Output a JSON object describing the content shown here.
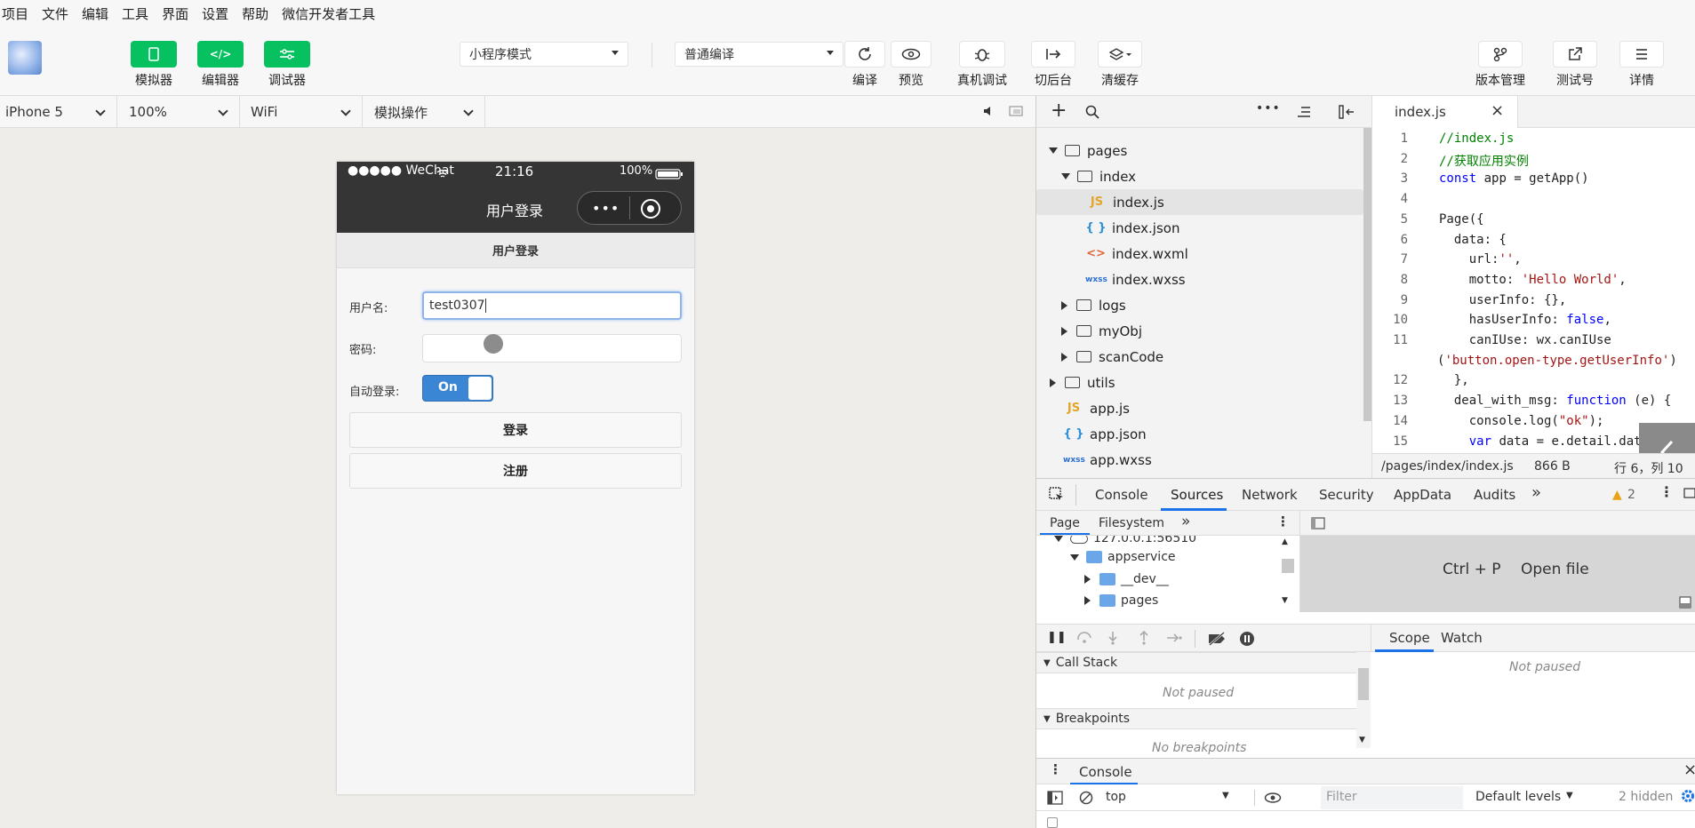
{
  "menu": [
    "项目",
    "文件",
    "编辑",
    "工具",
    "界面",
    "设置",
    "帮助",
    "微信开发者工具"
  ],
  "toolbar": {
    "simulator": "模拟器",
    "editor": "编辑器",
    "debugger": "调试器",
    "mode_select": "小程序模式",
    "compile_select": "普通编译",
    "compile": "编译",
    "preview": "预览",
    "remote_debug": "真机调试",
    "switch_bg": "切后台",
    "clear_cache": "清缓存",
    "version": "版本管理",
    "test_account": "测试号",
    "details": "详情"
  },
  "devicebar": {
    "device": "iPhone 5",
    "zoom": "100%",
    "network": "WiFi",
    "operation": "模拟操作"
  },
  "phone": {
    "carrier": "●●●●● WeChat",
    "time": "21:16",
    "battery": "100%",
    "nav_title": "用户登录",
    "page_header": "用户登录",
    "username_label": "用户名:",
    "username_value": "test0307",
    "password_label": "密码:",
    "autologin_label": "自动登录:",
    "switch_text": "On",
    "login_button": "登录",
    "register_button": "注册"
  },
  "explorer": {
    "items": [
      {
        "label": "pages"
      },
      {
        "label": "index"
      },
      {
        "label": "index.js",
        "icon": "JS"
      },
      {
        "label": "index.json",
        "icon": "{ }"
      },
      {
        "label": "index.wxml",
        "icon": "<>"
      },
      {
        "label": "index.wxss",
        "icon": "wxss"
      },
      {
        "label": "logs"
      },
      {
        "label": "myObj"
      },
      {
        "label": "scanCode"
      },
      {
        "label": "utils"
      },
      {
        "label": "app.js",
        "icon": "JS"
      },
      {
        "label": "app.json",
        "icon": "{ }"
      },
      {
        "label": "app.wxss",
        "icon": "wxss"
      }
    ]
  },
  "editor": {
    "tab": "index.js",
    "line_numbers": [
      "1",
      "2",
      "3",
      "4",
      "5",
      "6",
      "7",
      "8",
      "9",
      "10",
      "11",
      "",
      "12",
      "13",
      "14",
      "15"
    ],
    "lines": [
      "//index.js",
      "//获取应用实例",
      "const app = getApp()",
      "",
      "Page({",
      "  data: {",
      "    url:'',",
      "    motto: 'Hello World',",
      "    userInfo: {},",
      "    hasUserInfo: false,",
      "    canIUse: wx.canIUse",
      "('button.open-type.getUserInfo')",
      "  },",
      "  deal_with_msg: function (e) {",
      "    console.log(\"ok\");",
      "    var data = e.detail.data"
    ],
    "path": "/pages/index/index.js",
    "size": "866 B",
    "position": "行 6，列 10"
  },
  "devtools": {
    "tabs": [
      "Console",
      "Sources",
      "Network",
      "Security",
      "AppData",
      "Audits"
    ],
    "more": "»",
    "warnings": "2",
    "subtabs": [
      "Page",
      "Filesystem"
    ],
    "tree": [
      "127.0.0.1:56510",
      "appservice",
      "__dev__",
      "pages"
    ],
    "shortcut": "Ctrl + P",
    "open_file": "Open file",
    "scope": "Scope",
    "watch": "Watch",
    "not_paused_right": "Not paused",
    "call_stack": "Call Stack",
    "not_paused": "Not paused",
    "breakpoints": "Breakpoints",
    "no_breakpoints": "No breakpoints",
    "console_tab": "Console",
    "context": "top",
    "filter_placeholder": "Filter",
    "levels": "Default levels",
    "hidden": "2 hidden"
  },
  "colors": {
    "green": "#07c160",
    "dark_nav": "#353535",
    "accent_blue": "#1a73e8"
  }
}
